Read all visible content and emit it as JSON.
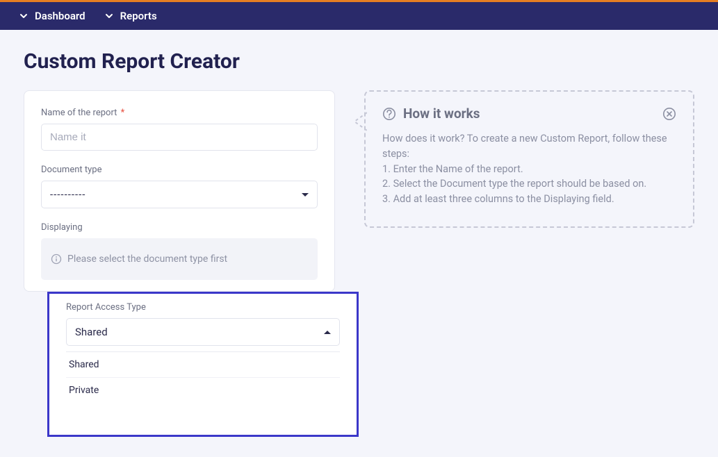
{
  "nav": {
    "items": [
      {
        "label": "Dashboard"
      },
      {
        "label": "Reports"
      }
    ]
  },
  "page": {
    "title": "Custom Report Creator"
  },
  "form": {
    "name": {
      "label": "Name of the report",
      "placeholder": "Name it",
      "required_mark": "*"
    },
    "document_type": {
      "label": "Document type",
      "selected": "----------"
    },
    "displaying": {
      "label": "Displaying",
      "empty_hint": "Please select the document type first"
    },
    "access_type": {
      "label": "Report Access Type",
      "selected": "Shared",
      "options": [
        "Shared",
        "Private"
      ]
    }
  },
  "help": {
    "title": "How it works",
    "intro": "How does it work? To create a new Custom Report, follow these steps:",
    "steps": [
      "1. Enter the Name of the report.",
      "2. Select the Document type the report should be based on.",
      "3. Add at least three columns to the Displaying field."
    ]
  }
}
